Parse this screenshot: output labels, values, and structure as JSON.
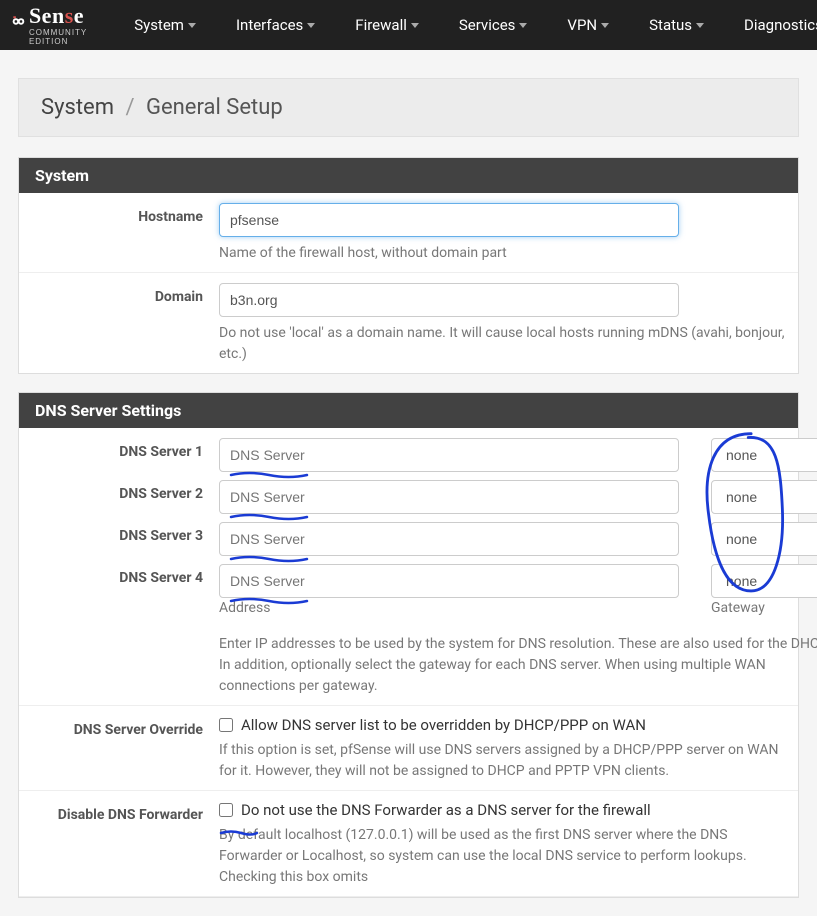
{
  "nav": {
    "items": [
      {
        "label": "System"
      },
      {
        "label": "Interfaces"
      },
      {
        "label": "Firewall"
      },
      {
        "label": "Services"
      },
      {
        "label": "VPN"
      },
      {
        "label": "Status"
      },
      {
        "label": "Diagnostics"
      }
    ]
  },
  "logo": {
    "community": "COMMUNITY EDITION"
  },
  "breadcrumb": {
    "root": "System",
    "current": "General Setup"
  },
  "sections": {
    "system": {
      "title": "System",
      "hostname": {
        "label": "Hostname",
        "value": "pfsense",
        "help": "Name of the firewall host, without domain part"
      },
      "domain": {
        "label": "Domain",
        "value": "b3n.org",
        "help": "Do not use 'local' as a domain name. It will cause local hosts running mDNS (avahi, bonjour, etc.)"
      }
    },
    "dns": {
      "title": "DNS Server Settings",
      "servers": [
        {
          "label": "DNS Server 1",
          "placeholder": "DNS Server",
          "value": "",
          "gateway": "none"
        },
        {
          "label": "DNS Server 2",
          "placeholder": "DNS Server",
          "value": "",
          "gateway": "none"
        },
        {
          "label": "DNS Server 3",
          "placeholder": "DNS Server",
          "value": "",
          "gateway": "none"
        },
        {
          "label": "DNS Server 4",
          "placeholder": "DNS Server",
          "value": "",
          "gateway": "none"
        }
      ],
      "col_address": "Address",
      "col_gateway": "Gateway",
      "help": "Enter IP addresses to be used by the system for DNS resolution. These are also used for the DHCP. In addition, optionally select the gateway for each DNS server. When using multiple WAN connections per gateway.",
      "override": {
        "label": "DNS Server Override",
        "checkbox_label": "Allow DNS server list to be overridden by DHCP/PPP on WAN",
        "help": "If this option is set, pfSense will use DNS servers assigned by a DHCP/PPP server on WAN for it. However, they will not be assigned to DHCP and PPTP VPN clients."
      },
      "disable_forwarder": {
        "label": "Disable DNS Forwarder",
        "checkbox_label": "Do not use the DNS Forwarder as a DNS server for the firewall",
        "help": "By default localhost (127.0.0.1) will be used as the first DNS server where the DNS Forwarder or Localhost, so system can use the local DNS service to perform lookups. Checking this box omits"
      }
    }
  }
}
